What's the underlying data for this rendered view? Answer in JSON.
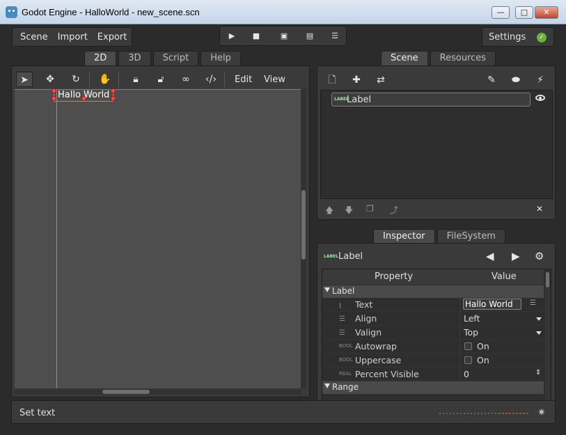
{
  "window": {
    "title": "Godot Engine - HalloWorld - new_scene.scn",
    "controls": [
      "minimize",
      "maximize",
      "close"
    ]
  },
  "menubar": {
    "items": [
      "Scene",
      "Import",
      "Export"
    ]
  },
  "playbar": {
    "buttons": [
      "play-icon",
      "stop-icon",
      "play-scene-icon",
      "play-custom-icon",
      "debug-options-icon"
    ]
  },
  "settings": {
    "label": "Settings",
    "status_icon": "check-icon"
  },
  "main_tabs": [
    {
      "label": "2D",
      "active": true
    },
    {
      "label": "3D",
      "active": false
    },
    {
      "label": "Script",
      "active": false
    },
    {
      "label": "Help",
      "active": false
    }
  ],
  "viewport_toolbar": {
    "tools": [
      "select-icon",
      "move-icon",
      "rotate-icon",
      "pan-icon",
      "lock-icon",
      "unlock-icon",
      "group-icon",
      "ungroup-icon"
    ],
    "menus": [
      "Edit",
      "View"
    ]
  },
  "canvas": {
    "label_text": "Hallo World"
  },
  "dock_tabs_top": [
    {
      "label": "Scene",
      "active": true
    },
    {
      "label": "Resources",
      "active": false
    }
  ],
  "scene_tree": {
    "tools": [
      "new-script-icon",
      "add-node-icon",
      "instance-icon",
      "plugin-icon",
      "groups-icon",
      "connections-icon"
    ],
    "nodes": [
      {
        "type_badge": "LABEL",
        "name": "Label",
        "visible_icon": "eye-icon"
      }
    ],
    "bottom_tools": [
      "move-up-icon",
      "move-down-icon",
      "duplicate-icon",
      "reparent-icon",
      "delete-icon"
    ]
  },
  "dock_tabs_bottom": [
    {
      "label": "Inspector",
      "active": true
    },
    {
      "label": "FileSystem",
      "active": false
    }
  ],
  "inspector": {
    "type_badge": "LABEL",
    "object_name": "Label",
    "columns": {
      "property": "Property",
      "value": "Value"
    },
    "sections": [
      {
        "name": "Label",
        "expanded": true
      },
      {
        "name": "Range",
        "expanded": true
      }
    ],
    "properties": [
      {
        "type": "text",
        "name": "Text",
        "value": "Hallo World",
        "kind": "textbox"
      },
      {
        "type": "list",
        "name": "Align",
        "value": "Left",
        "kind": "dropdown"
      },
      {
        "type": "list",
        "name": "Valign",
        "value": "Top",
        "kind": "dropdown"
      },
      {
        "type": "BOOL",
        "name": "Autowrap",
        "value": "On",
        "kind": "checkbox",
        "checked": false
      },
      {
        "type": "BOOL",
        "name": "Uppercase",
        "value": "On",
        "kind": "checkbox",
        "checked": false
      },
      {
        "type": "REAL",
        "name": "Percent Visible",
        "value": "0",
        "kind": "spinner"
      }
    ]
  },
  "statusbar": {
    "message": "Set text"
  }
}
